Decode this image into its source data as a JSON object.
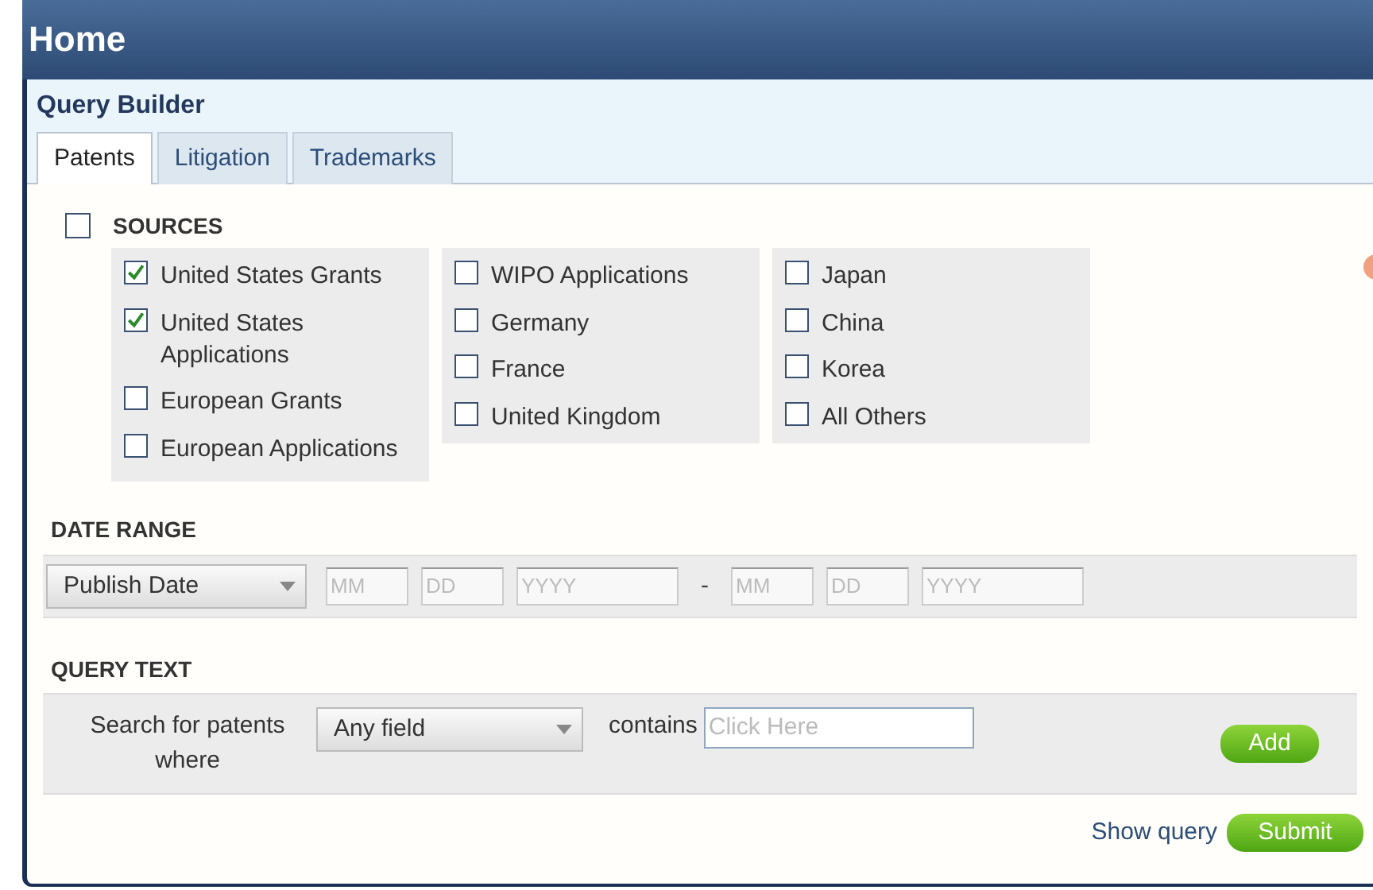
{
  "header": {
    "title": "Home"
  },
  "panel": {
    "title": "Query Builder"
  },
  "tabs": [
    {
      "label": "Patents",
      "selected": true
    },
    {
      "label": "Litigation",
      "selected": false
    },
    {
      "label": "Trademarks",
      "selected": false
    }
  ],
  "sources": {
    "label": "SOURCES",
    "checked": false,
    "groups": [
      [
        {
          "label": "United States Grants",
          "checked": true
        },
        {
          "label": "United States Applications",
          "checked": true
        },
        {
          "label": "European Grants",
          "checked": false
        },
        {
          "label": "European Applications",
          "checked": false
        }
      ],
      [
        {
          "label": "WIPO Applications",
          "checked": false
        },
        {
          "label": "Germany",
          "checked": false
        },
        {
          "label": "France",
          "checked": false
        },
        {
          "label": "United Kingdom",
          "checked": false
        }
      ],
      [
        {
          "label": "Japan",
          "checked": false
        },
        {
          "label": "China",
          "checked": false
        },
        {
          "label": "Korea",
          "checked": false
        },
        {
          "label": "All Others",
          "checked": false
        }
      ]
    ]
  },
  "date_range": {
    "label": "DATE RANGE",
    "type_select": "Publish Date",
    "from": [
      {
        "placeholder": "MM"
      },
      {
        "placeholder": "DD"
      },
      {
        "placeholder": "YYYY"
      }
    ],
    "separator": "-",
    "to": [
      {
        "placeholder": "MM"
      },
      {
        "placeholder": "DD"
      },
      {
        "placeholder": "YYYY"
      }
    ]
  },
  "query_text": {
    "label": "QUERY TEXT",
    "prompt": "Search for patents where",
    "field_select": "Any field",
    "operator": "contains",
    "value": {
      "placeholder": "Click Here"
    },
    "add_button": "Add"
  },
  "footer": {
    "show_query_link": "Show query",
    "submit_button": "Submit"
  }
}
